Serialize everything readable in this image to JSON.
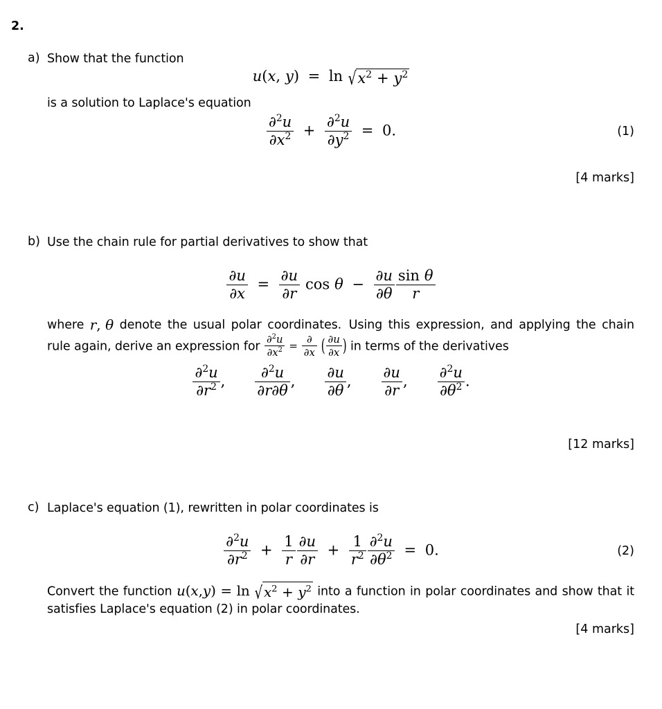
{
  "document": {
    "question_number": "2.",
    "type": "mathematics-exam-question"
  },
  "parts": [
    {
      "label": "a)",
      "lines": [
        "Show that the function",
        "is a solution to Laplace's equation"
      ],
      "equation_1": {
        "latex": "u(x,y) = \\ln \\sqrt{x^2+y^2}",
        "plain": "u(x, y) = ln sqrt(x^2 + y^2)",
        "tokens": {
          "lhs_u": "u",
          "lhs_open": "(",
          "lhs_x": "x",
          "lhs_comma": ",",
          "lhs_y": "y",
          "lhs_close": ")",
          "equals": "=",
          "ln": "ln",
          "radical": "√",
          "x": "x",
          "plus": "+",
          "y": "y",
          "exp": "2"
        }
      },
      "equation_2": {
        "latex": "\\frac{\\partial^2 u}{\\partial x^2} + \\frac{\\partial^2 u}{\\partial y^2} = 0.",
        "plain": "d^2u/dx^2 + d^2u/dy^2 = 0.",
        "number": "(1)",
        "tokens": {
          "partial": "∂",
          "u": "u",
          "x": "x",
          "y": "y",
          "exp": "2",
          "plus": "+",
          "equals": "=",
          "zero": "0."
        }
      },
      "marks": "[4 marks]"
    },
    {
      "label": "b)",
      "lines": [
        "Use the chain rule for partial derivatives to show that"
      ],
      "equation_1": {
        "latex": "\\frac{\\partial u}{\\partial x} = \\frac{\\partial u}{\\partial r}\\cos\\theta - \\frac{\\partial u}{\\partial\\theta}\\frac{\\sin\\theta}{r}",
        "plain": "du/dx = du/dr cos(theta) - du/dtheta * sin(theta)/r",
        "tokens": {
          "partial": "∂",
          "u": "u",
          "x": "x",
          "r": "r",
          "theta": "θ",
          "cos": "cos",
          "sin": "sin",
          "equals": "=",
          "minus": "−"
        }
      },
      "paragraph_prefix": "where ",
      "paragraph_mid": " denote the usual polar coordinates.",
      "paragraph_mid2": "Using this expression, and applying the chain rule again, derive an expression for ",
      "paragraph_suffix": " in terms of the derivatives",
      "inline_math_rtheta": {
        "plain": "r, theta",
        "r": "r",
        "comma": ",",
        "theta": "θ"
      },
      "inline_math_deriv": {
        "latex": "\\frac{\\partial^2 u}{\\partial x^2} = \\frac{\\partial}{\\partial x}\\left(\\frac{\\partial u}{\\partial x}\\right)",
        "plain": "d^2u/dx^2 = d/dx (du/dx)"
      },
      "derivative_list": {
        "latex": "\\frac{\\partial^2 u}{\\partial r^2},\\ \\frac{\\partial^2 u}{\\partial r\\partial\\theta},\\ \\frac{\\partial u}{\\partial\\theta},\\ \\frac{\\partial u}{\\partial r},\\ \\frac{\\partial^2 u}{\\partial\\theta^2}.",
        "plain": "d^2u/dr^2, d^2u/drdtheta, du/dtheta, du/dr, d^2u/dtheta^2.",
        "items": [
          "d2u/dr2",
          "d2u/drdtheta",
          "du/dtheta",
          "du/dr",
          "d2u/dtheta2"
        ],
        "separators": [
          ",",
          ",",
          ",",
          ",",
          "."
        ]
      },
      "marks": "[12 marks]"
    },
    {
      "label": "c)",
      "lines": [
        "Laplace's equation (1), rewritten in polar coordinates is"
      ],
      "equation_1": {
        "latex": "\\frac{\\partial^2 u}{\\partial r^2} + \\frac{1}{r}\\frac{\\partial u}{\\partial r} + \\frac{1}{r^2}\\frac{\\partial^2 u}{\\partial\\theta^2} = 0.",
        "plain": "d^2u/dr^2 + (1/r) du/dr + (1/r^2) d^2u/dtheta^2 = 0.",
        "number": "(2)",
        "tokens": {
          "one": "1",
          "r": "r",
          "theta": "θ",
          "u": "u",
          "partial": "∂",
          "zero": "0."
        }
      },
      "paragraph_prefix": "Convert the function ",
      "paragraph_suffix": " into a function in polar coordinates and show that it satisfies Laplace's equation (2) in polar coordinates.",
      "inline_function": {
        "latex": "u(x,y) = \\ln\\sqrt{x^2+y^2}",
        "plain": "u(x, y) = ln sqrt(x^2 + y^2)"
      },
      "marks": "[4 marks]"
    }
  ],
  "symbols": {
    "partial": "∂",
    "theta": "θ",
    "radical": "√",
    "minus": "−",
    "plus": "+",
    "equals": "="
  }
}
